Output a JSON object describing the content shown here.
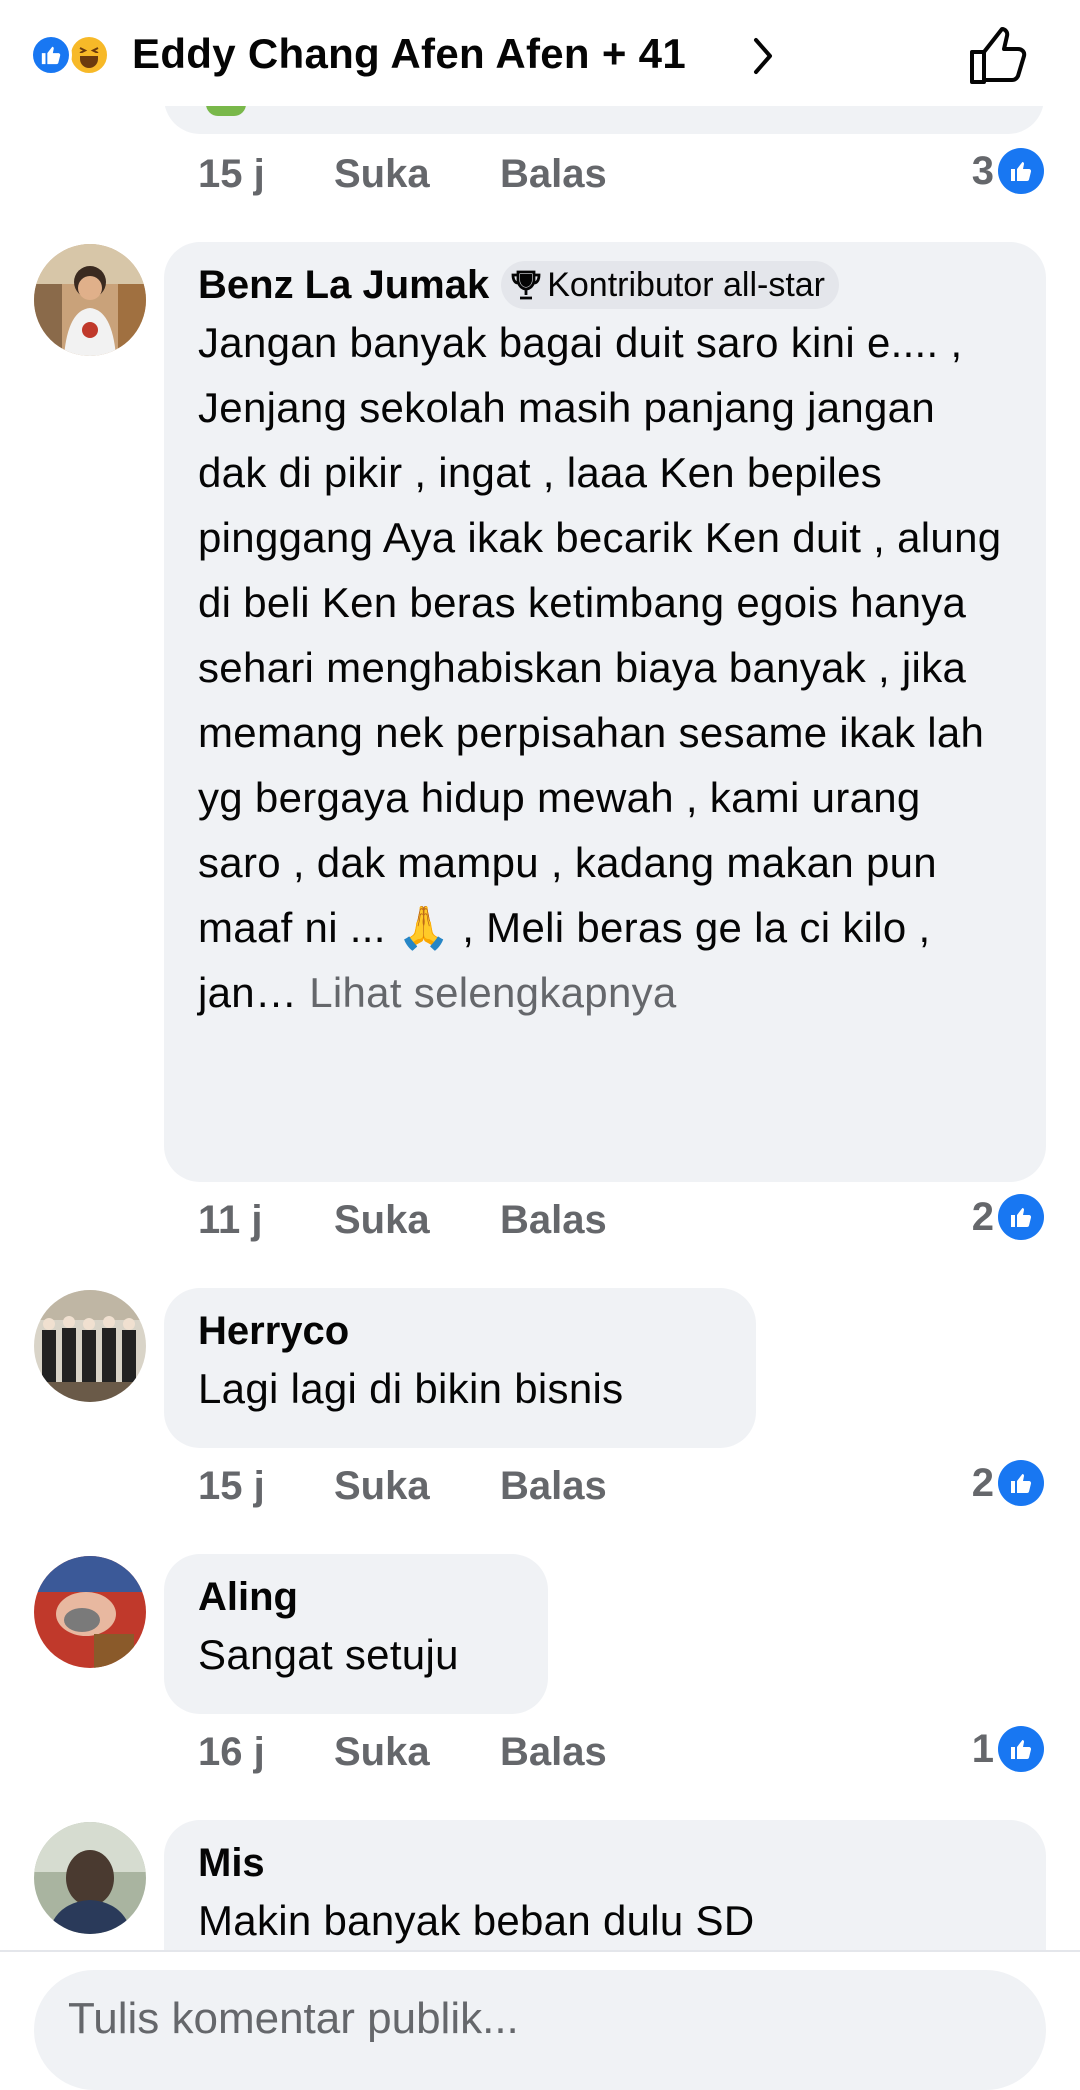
{
  "header": {
    "names": "Eddy Chang Afen Afen + 41",
    "reaction_icons": [
      "like-reaction-icon",
      "haha-reaction-icon"
    ],
    "like_icon": "thumbs-up-icon"
  },
  "previous_comment": {
    "time": "15 j",
    "like": "Suka",
    "reply": "Balas",
    "reactions": "3"
  },
  "comments": [
    {
      "author": "Benz La Jumak",
      "badge": "Kontributor all-star",
      "text": "Jangan banyak bagai duit saro kini e.... , Jenjang sekolah masih panjang jangan dak di pikir , ingat , laaa Ken bepiles pinggang Aya ikak becarik Ken duit , alung di beli Ken beras ketimbang egois hanya sehari menghabiskan biaya banyak , jika memang nek perpisahan sesame ikak lah yg bergaya hidup mewah , kami urang saro , dak mampu , kadang makan pun maaf ni ... 🙏 , Meli beras ge la ci kilo , jan…",
      "see_more": "Lihat selengkapnya",
      "time": "11 j",
      "like": "Suka",
      "reply": "Balas",
      "reactions": "2"
    },
    {
      "author": "Herryco",
      "text": "Lagi lagi di bikin bisnis",
      "time": "15 j",
      "like": "Suka",
      "reply": "Balas",
      "reactions": "2"
    },
    {
      "author": "Aling",
      "text": "Sangat setuju",
      "time": "16 j",
      "like": "Suka",
      "reply": "Balas",
      "reactions": "1"
    },
    {
      "author": "Mis",
      "text": "Makin banyak beban dulu SD"
    }
  ],
  "composer": {
    "placeholder": "Tulis komentar publik..."
  },
  "colors": {
    "accent": "#1877f2",
    "bubble": "#f0f2f5",
    "secondary_text": "#65676b"
  }
}
